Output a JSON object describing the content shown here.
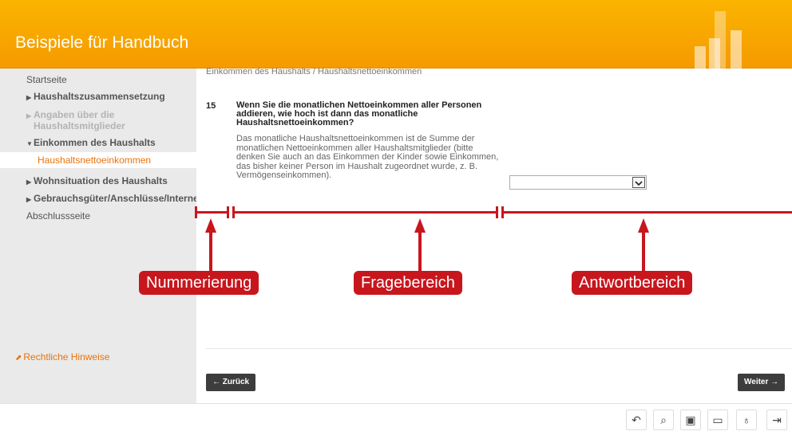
{
  "header": {
    "title": "Beispiele für Handbuch"
  },
  "sidebar": {
    "items": [
      {
        "label": "Startseite"
      },
      {
        "label": "Haushaltszusammensetzung"
      },
      {
        "label": "Angaben über die Haushaltsmitglieder"
      },
      {
        "label": "Einkommen des Haushalts"
      },
      {
        "label": "Haushaltsnettoeinkommen"
      },
      {
        "label": "Wohnsituation des Haushalts"
      },
      {
        "label": "Gebrauchsgüter/Anschlüsse/Interne"
      },
      {
        "label": "Abschlussseite"
      }
    ],
    "legal_label": "Rechtliche Hinweise"
  },
  "main": {
    "breadcrumb": "Einkommen des Haushalts / Haushaltsnettoeinkommen",
    "question": {
      "number": "15",
      "text": "Wenn Sie die monatlichen Nettoeinkommen aller Personen addieren, wie hoch ist dann das monatliche Haushaltsnettoeinkommen?",
      "help": "Das monatliche Haushaltsnettoeinkommen ist de Summe der monatlichen Nettoeinkommen aller Haushaltsmitglieder (bitte denken Sie auch an das Einkommen der Kinder sowie Einkommen, das bisher keiner Person im Haushalt zugeordnet wurde, z. B. Vermögenseinkommen)."
    },
    "answer": {
      "value": ""
    }
  },
  "annotations": {
    "labels": [
      "Nummerierung",
      "Fragebereich",
      "Antwortbereich"
    ],
    "color": "#c8161d"
  },
  "nav": {
    "back_label": "Zurück",
    "next_label": "Weiter"
  },
  "toolbar": {
    "icons": [
      "undo-icon",
      "search-icon",
      "save-icon",
      "open-folder-icon",
      "translate-icon",
      "exit-icon"
    ]
  },
  "colors": {
    "brand": "#f59a00",
    "accent": "#e8730c",
    "sidebar_bg": "#eaeaea",
    "button_dark": "#3d3d3d"
  }
}
